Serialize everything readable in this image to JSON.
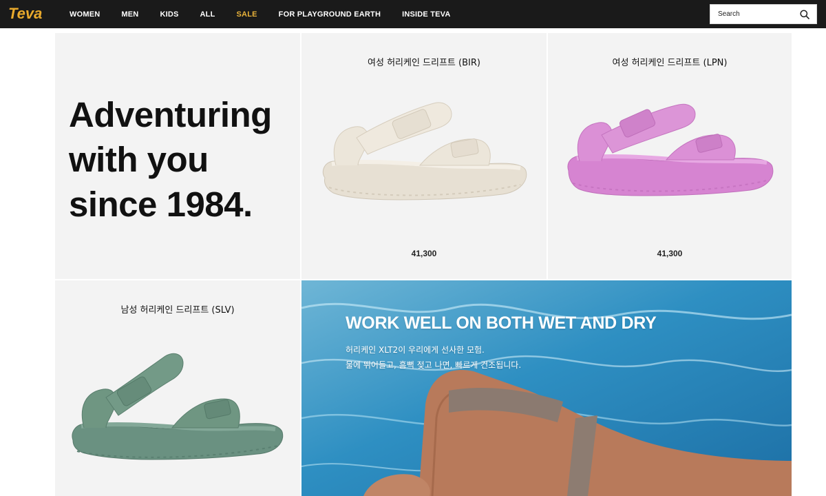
{
  "header": {
    "logo_text": "Teva",
    "nav": [
      "WOMEN",
      "MEN",
      "KIDS",
      "ALL",
      "SALE",
      "FOR PLAYGROUND EARTH",
      "INSIDE TEVA"
    ],
    "sale_color": "#e8b23a",
    "search": {
      "placeholder": "Search",
      "icon": "search-icon"
    }
  },
  "hero": {
    "lines": [
      "Adventuring",
      "with you",
      "since 1984."
    ]
  },
  "products": [
    {
      "name": "여성 허리케인 드리프트 (BIR)",
      "price": "41,300",
      "color": "#ece6da"
    },
    {
      "name": "여성 허리케인 드리프트 (LPN)",
      "price": "41,300",
      "color": "#d98fd4"
    },
    {
      "name": "남성 허리케인 드리프트 (SLV)",
      "price": "",
      "color": "#6f9682"
    }
  ],
  "banner": {
    "title": "WORK WELL ON BOTH WET AND DRY",
    "lines": [
      "허리케인 XLT2이 우리에게 선사한 모험.",
      "물에 뛰어들고, 흠뻑 젖고 나면, 빠르게 건조됩니다."
    ]
  }
}
